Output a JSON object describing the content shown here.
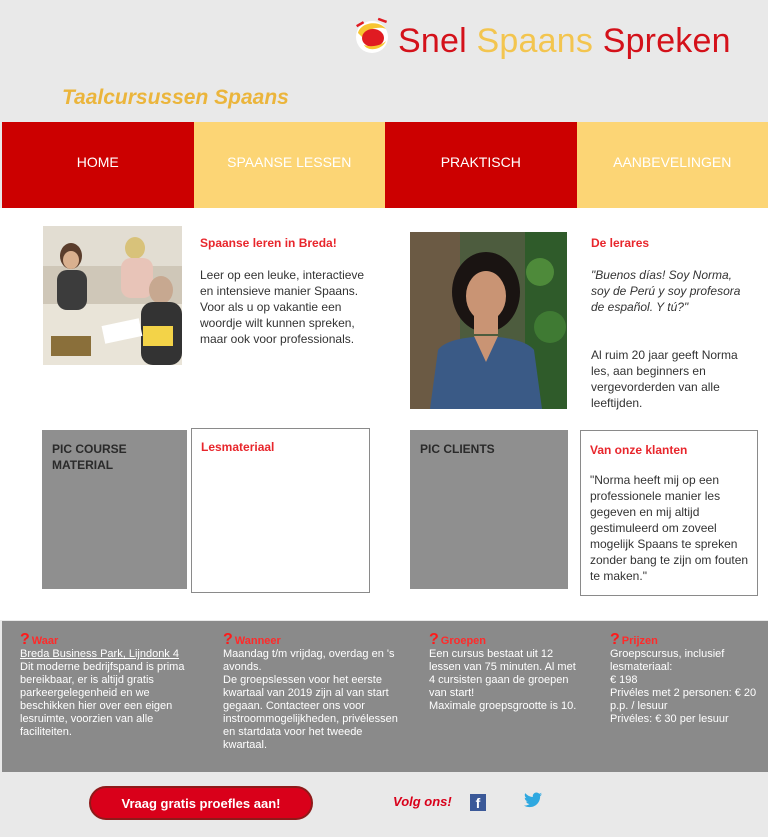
{
  "brand": {
    "word1": "Snel",
    "word2": "Spaans",
    "word3": "Spreken",
    "subtitle": "Taalcursussen Spaans"
  },
  "nav": [
    {
      "label": "HOME"
    },
    {
      "label": "SPAANSE LESSEN"
    },
    {
      "label": "PRAKTISCH"
    },
    {
      "label": "AANBEVELINGEN"
    }
  ],
  "intro": {
    "title": "Spaanse leren in Breda!",
    "text": "Leer op een leuke, interactieve en intensieve manier Spaans. Voor als u op vakantie een woordje wilt kunnen spreken, maar ook voor professionals."
  },
  "teacher": {
    "title": "De lerares",
    "quote": "\"Buenos días! Soy Norma, soy de Perú y soy profesora de español. Y tú?\"",
    "text": "Al ruim 20 jaar geeft Norma les, aan beginners en vergevorderden van alle leeftijden."
  },
  "material": {
    "pic_label": "PIC COURSE MATERIAL",
    "title": "Lesmateriaal"
  },
  "clients": {
    "pic_label": "PIC CLIENTS",
    "title": "Van onze klanten",
    "text": "\"Norma heeft mij op een professionele manier les gegeven en mij altijd gestimuleerd om zoveel mogelijk Spaans te spreken zonder bang te zijn om fouten te maken.\""
  },
  "footer": {
    "waar": {
      "title": "Waar",
      "link": "Breda Business Park, Lijndonk 4",
      "text": "Dit moderne bedrijfspand is prima bereikbaar, er is altijd gratis parkeergelegenheid en we beschikken hier over een eigen lesruimte, voorzien van alle faciliteiten."
    },
    "wanneer": {
      "title": "Wanneer",
      "text1": "Maandag t/m vrijdag, overdag en 's avonds.",
      "text2": "De groepslessen voor het eerste kwartaal van 2019 zijn al van start gegaan. Contacteer ons voor instroommogelijkheden, privélessen en startdata voor het tweede kwartaal."
    },
    "groepen": {
      "title": "Groepen",
      "text1": "Een cursus bestaat uit 12 lessen van 75 minuten. Al met 4 cursisten gaan de groepen van start!",
      "text2": "Maximale groepsgrootte is 10."
    },
    "prijzen": {
      "title": "Prijzen",
      "line1": "Groepscursus, inclusief lesmateriaal:",
      "line2": "€ 198",
      "line3": "Privéles met 2 personen: € 20 p.p. / lesuur",
      "line4": "Privéles: € 30 per lesuur"
    }
  },
  "cta": {
    "label": "Vraag gratis proefles aan!"
  },
  "social": {
    "follow": "Volg ons!",
    "fb": "f"
  },
  "colors": {
    "red": "#cc0000",
    "yellow": "#fcd575",
    "accent_yellow": "#f3c54f",
    "grey": "#8a8a8a"
  }
}
